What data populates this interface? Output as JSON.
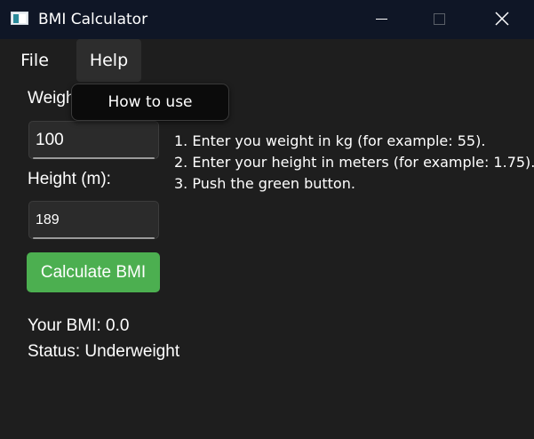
{
  "window": {
    "title": "BMI Calculator",
    "icons": {
      "app": "calculator-app-icon",
      "minimize": "minimize-icon",
      "maximize": "maximize-icon",
      "close": "close-icon"
    }
  },
  "menu": {
    "file_label": "File",
    "help_label": "Help",
    "help_dropdown": {
      "how_to_use_label": "How to use"
    }
  },
  "form": {
    "weight_label": "Weight (kg):",
    "weight_value": "100",
    "height_label": "Height (m):",
    "height_value": "189",
    "calculate_label": "Calculate BMI"
  },
  "instructions": [
    "1. Enter you weight in kg (for example: 55).",
    "2. Enter your height in meters (for example: 1.75).",
    "3. Push the green button."
  ],
  "result": {
    "bmi_text": "Your BMI: 0.0",
    "status_text": "Status: Underweight"
  },
  "colors": {
    "window_bg": "#1e1e1e",
    "titlebar_bg": "#0f1626",
    "button_green": "#4caf50",
    "input_bg": "#2b2b2b",
    "dropdown_bg": "#0b0b0b"
  }
}
